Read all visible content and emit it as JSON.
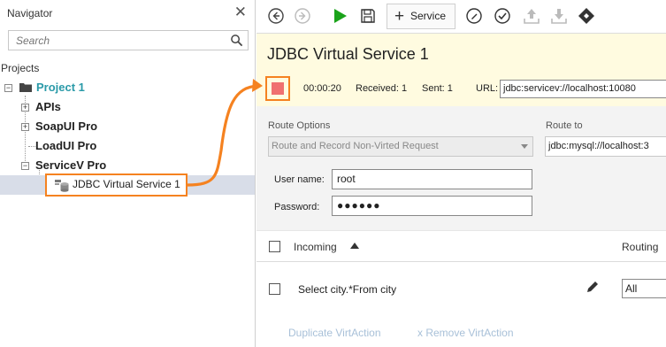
{
  "navigator": {
    "title": "Navigator",
    "search_placeholder": "Search",
    "projects_label": "Projects",
    "project_name": "Project 1",
    "items": [
      {
        "label": "APIs"
      },
      {
        "label": "SoapUI Pro"
      },
      {
        "label": "LoadUI Pro"
      },
      {
        "label": "ServiceV Pro"
      }
    ],
    "virtual_service": "JDBC Virtual Service 1"
  },
  "toolbar": {
    "service_label": "Service"
  },
  "service": {
    "title": "JDBC Virtual Service 1",
    "elapsed": "00:00:20",
    "received": "Received: 1",
    "sent": "Sent: 1",
    "url_label": "URL:",
    "url_value": "jdbc:servicev://localhost:10080"
  },
  "route": {
    "options_label": "Route Options",
    "options_value": "Route and Record Non-Virted Request",
    "route_to_label": "Route to",
    "route_to_value": "jdbc:mysql://localhost:3",
    "username_label": "User name:",
    "username_value": "root",
    "password_label": "Password:",
    "password_value": "●●●●●●"
  },
  "actions_list": {
    "incoming_header": "Incoming",
    "routing_header": "Routing",
    "rows": [
      {
        "incoming": "Select city.*From city",
        "routing": "All"
      }
    ],
    "duplicate_label": "Duplicate VirtAction",
    "remove_label": "x Remove VirtAction"
  },
  "colors": {
    "accent_orange": "#f58220",
    "project_teal": "#2a9aa8",
    "run_green": "#1aa31a",
    "panel_yellow": "#fffbe0",
    "stop_red": "#f07070"
  }
}
